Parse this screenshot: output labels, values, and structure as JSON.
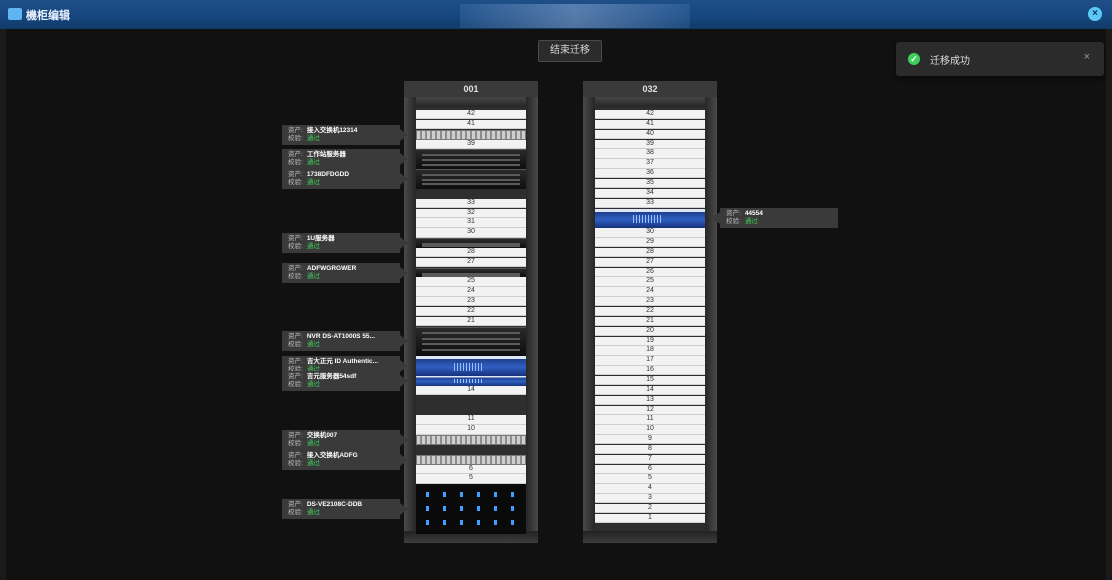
{
  "window": {
    "title": "機柜编辑",
    "close_icon": "close-circle-icon"
  },
  "toolbar": {
    "end_migration_label": "结束迁移"
  },
  "toast": {
    "message": "迁移成功",
    "icon": "check-circle-icon",
    "close_label": "×"
  },
  "labels": {
    "asset": "资产:",
    "check": "校验:"
  },
  "racks": [
    {
      "name": "001",
      "units": [
        {
          "u": 42,
          "label": "42"
        },
        {
          "u": 41,
          "label": "41"
        },
        {
          "u": 39,
          "label": "39"
        },
        {
          "u": 33,
          "label": "33"
        },
        {
          "u": 32,
          "label": "32"
        },
        {
          "u": 31,
          "label": "31"
        },
        {
          "u": 30,
          "label": "30"
        },
        {
          "u": 28,
          "label": "28"
        },
        {
          "u": 27,
          "label": "27"
        },
        {
          "u": 25,
          "label": "25"
        },
        {
          "u": 24,
          "label": "24"
        },
        {
          "u": 23,
          "label": "23"
        },
        {
          "u": 22,
          "label": "22"
        },
        {
          "u": 21,
          "label": "21"
        },
        {
          "u": 14,
          "label": "14"
        },
        {
          "u": 11,
          "label": "11"
        },
        {
          "u": 10,
          "label": "10"
        },
        {
          "u": 6,
          "label": "6"
        },
        {
          "u": 5,
          "label": "5"
        }
      ],
      "devices": [
        {
          "asset": "接入交换机12314",
          "check": "通过",
          "kind": "switch"
        },
        {
          "asset": "工作站服务器",
          "check": "通过",
          "kind": "server"
        },
        {
          "asset": "1738DFDGDD",
          "check": "通过",
          "kind": "server"
        },
        {
          "asset": "1U服务器",
          "check": "通过",
          "kind": "server"
        },
        {
          "asset": "ADFWGRGWER",
          "check": "通过",
          "kind": "server"
        },
        {
          "asset": "NVR DS-AT1000S 55...",
          "check": "通过",
          "kind": "server"
        },
        {
          "asset": "吉大正元 ID Authentic...",
          "check": "通过",
          "kind": "blue"
        },
        {
          "asset": "吉元服务器54sdf",
          "check": "通过",
          "kind": "blue"
        },
        {
          "asset": "交换机007",
          "check": "通过",
          "kind": "switch"
        },
        {
          "asset": "接入交换机ADFG",
          "check": "通过",
          "kind": "switch"
        },
        {
          "asset": "DS-VE2108C-DDB",
          "check": "通过",
          "kind": "storage"
        }
      ]
    },
    {
      "name": "032",
      "units": [
        {
          "u": 42,
          "label": "42"
        },
        {
          "u": 41,
          "label": "41"
        },
        {
          "u": 40,
          "label": "40"
        },
        {
          "u": 39,
          "label": "39"
        },
        {
          "u": 38,
          "label": "38"
        },
        {
          "u": 37,
          "label": "37"
        },
        {
          "u": 36,
          "label": "36"
        },
        {
          "u": 35,
          "label": "35"
        },
        {
          "u": 34,
          "label": "34"
        },
        {
          "u": 33,
          "label": "33"
        },
        {
          "u": 30,
          "label": "30"
        },
        {
          "u": 29,
          "label": "29"
        },
        {
          "u": 28,
          "label": "28"
        },
        {
          "u": 27,
          "label": "27"
        },
        {
          "u": 26,
          "label": "26"
        },
        {
          "u": 25,
          "label": "25"
        },
        {
          "u": 24,
          "label": "24"
        },
        {
          "u": 23,
          "label": "23"
        },
        {
          "u": 22,
          "label": "22"
        },
        {
          "u": 21,
          "label": "21"
        },
        {
          "u": 20,
          "label": "20"
        },
        {
          "u": 19,
          "label": "19"
        },
        {
          "u": 18,
          "label": "18"
        },
        {
          "u": 17,
          "label": "17"
        },
        {
          "u": 16,
          "label": "16"
        },
        {
          "u": 15,
          "label": "15"
        },
        {
          "u": 14,
          "label": "14"
        },
        {
          "u": 13,
          "label": "13"
        },
        {
          "u": 12,
          "label": "12"
        },
        {
          "u": 11,
          "label": "11"
        },
        {
          "u": 10,
          "label": "10"
        },
        {
          "u": 9,
          "label": "9"
        },
        {
          "u": 8,
          "label": "8"
        },
        {
          "u": 7,
          "label": "7"
        },
        {
          "u": 6,
          "label": "6"
        },
        {
          "u": 5,
          "label": "5"
        },
        {
          "u": 4,
          "label": "4"
        },
        {
          "u": 3,
          "label": "3"
        },
        {
          "u": 2,
          "label": "2"
        },
        {
          "u": 1,
          "label": "1"
        }
      ],
      "devices": [
        {
          "asset": "44554",
          "check": "通过",
          "kind": "blue"
        }
      ]
    }
  ]
}
